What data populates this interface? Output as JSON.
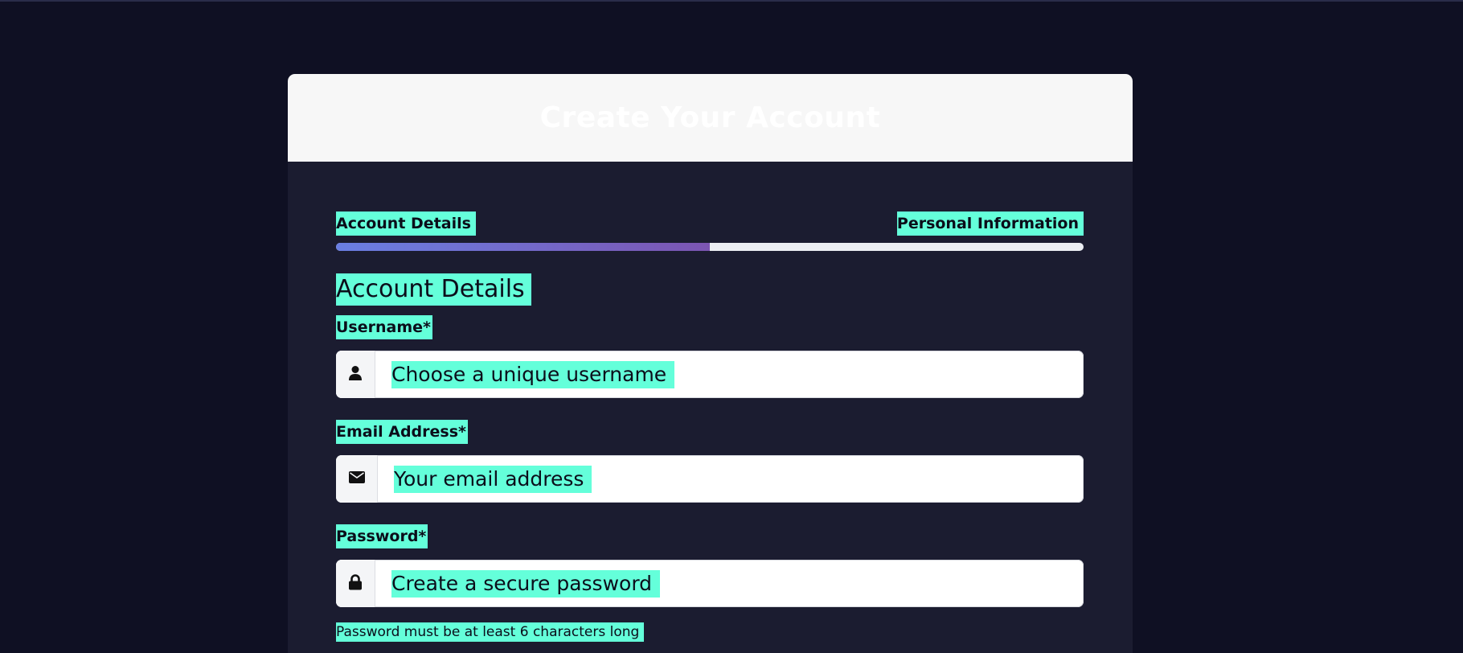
{
  "header": {
    "title": "Create Your Account"
  },
  "steps": {
    "labels": [
      "Account Details",
      "Personal Information"
    ],
    "progress_fraction": 0.5,
    "colors": {
      "start": "#6a7fe3",
      "end": "#7c55b2",
      "track": "#eceef3"
    }
  },
  "section": {
    "title": "Account Details"
  },
  "fields": {
    "username": {
      "label": "Username*",
      "placeholder": "Choose a unique username",
      "icon": "user-icon"
    },
    "email": {
      "label": "Email Address*",
      "placeholder": "Your email address",
      "icon": "envelope-icon"
    },
    "password": {
      "label": "Password*",
      "placeholder": "Create a secure password",
      "icon": "lock-icon",
      "hint": "Password must be at least 6 characters long"
    }
  },
  "theme": {
    "background": "#0f1023",
    "card": "#1b1c30",
    "highlight": "#64ffda"
  }
}
